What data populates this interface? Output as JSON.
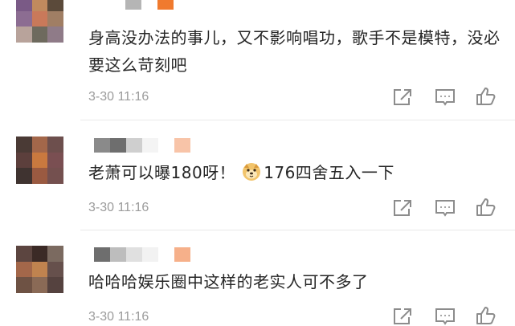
{
  "comments": [
    {
      "text": "身高没办法的事儿，又不影响唱功，歌手不是模特，没必要这么苛刻吧",
      "time": "3-30 11:16",
      "avatar_colors": [
        "#7a5a86",
        "#c08a5e",
        "#5b4a3a",
        "#8c6d92",
        "#c9795a",
        "#a07e64",
        "#b8a39b",
        "#6e6a5e",
        "#8f7b88"
      ],
      "username_colors": [
        "#ffffff",
        "#b5b5b5",
        "#ffffff",
        "#f07a2e"
      ]
    },
    {
      "text_before": "老萧可以曝180呀！",
      "text_after": "176四舍五入一下",
      "emoji": "doge-emoji",
      "time": "3-30 11:16",
      "avatar_colors": [
        "#4a3a35",
        "#a3674a",
        "#6d4f4d",
        "#5c3f3c",
        "#c9793f",
        "#7a4f52",
        "#3f3330",
        "#9a5a41",
        "#74504f"
      ],
      "username_colors": [
        "#8a8a8a",
        "#6e6e6e",
        "#cfcfcf",
        "#f4f4f4",
        "#ffffff",
        "#f8c4a8"
      ]
    },
    {
      "text": "哈哈哈娱乐圈中这样的老实人可不多了",
      "time": "3-30 11:16",
      "avatar_colors": [
        "#5c4540",
        "#3b2a26",
        "#7b6a60",
        "#a3674a",
        "#c0834f",
        "#66504c",
        "#6e5244",
        "#8a6a56",
        "#55423f"
      ],
      "username_colors": [
        "#6e6e6e",
        "#bdbdbd",
        "#e0e0e0",
        "#f2f2f2",
        "#ffffff",
        "#f6b08a"
      ]
    }
  ],
  "icons": {
    "share": "share-icon",
    "reply": "comment-icon",
    "like": "thumbs-up-icon"
  },
  "colors": {
    "text": "#262626",
    "meta": "#9b9b9b",
    "icon": "#8c8c8c",
    "divider": "#e9e9e9"
  }
}
